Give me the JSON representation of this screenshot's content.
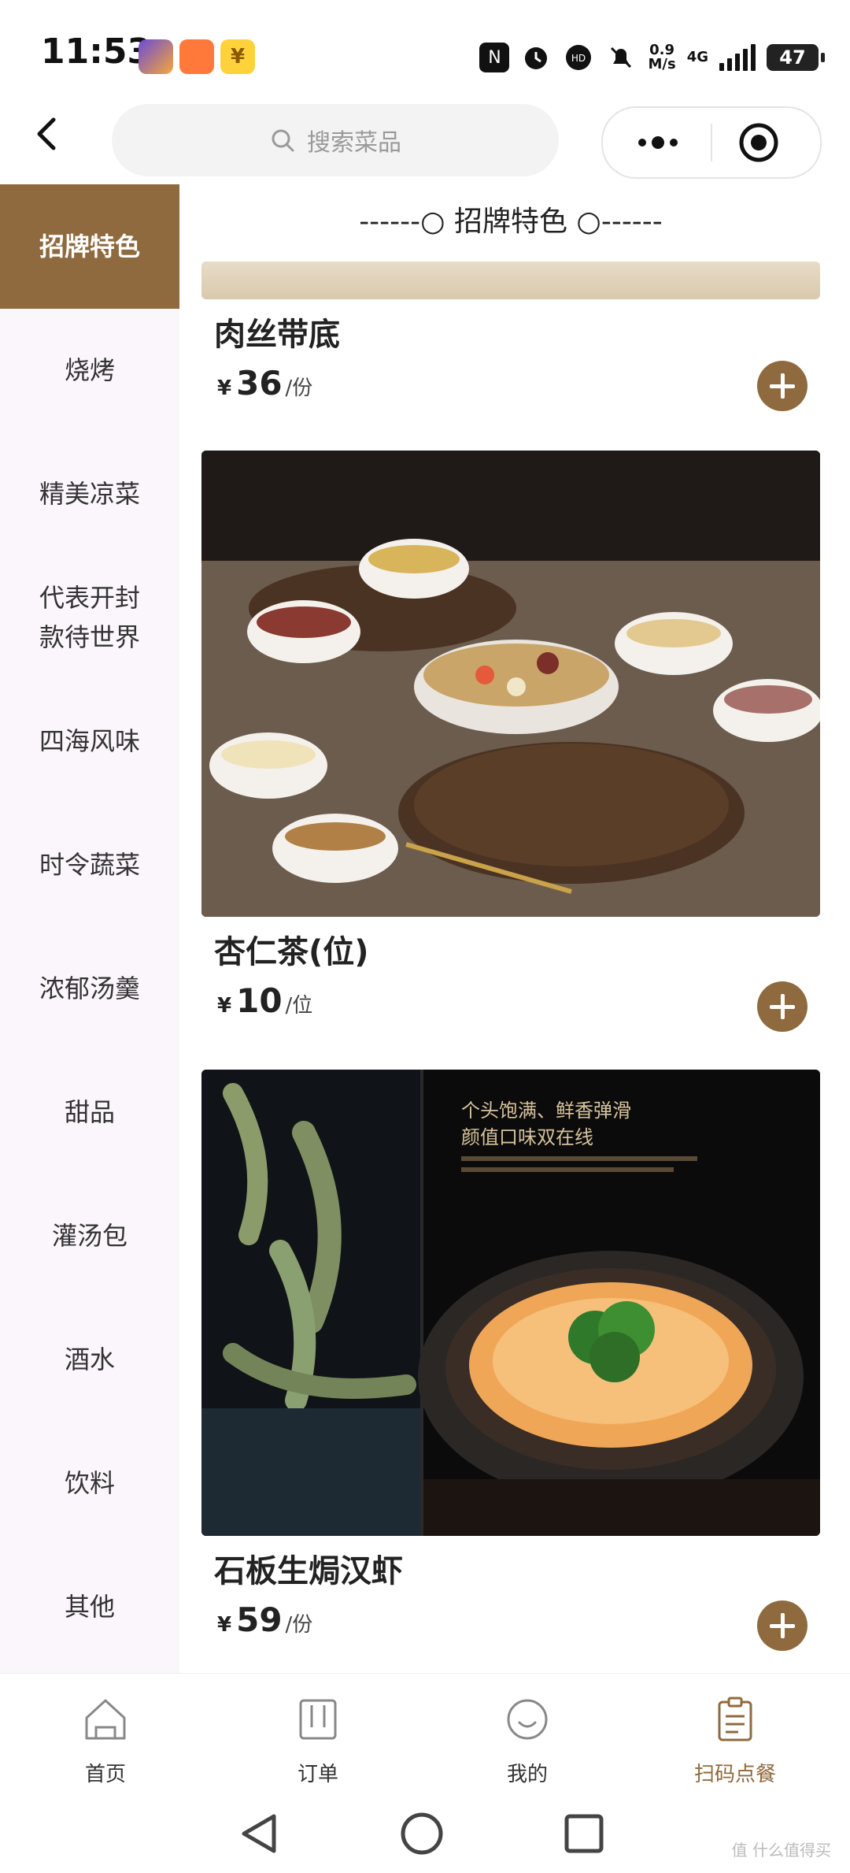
{
  "status_bar": {
    "time": "11:53",
    "net_speed_top": "0.9",
    "net_speed_bottom": "M/s",
    "network": "4G",
    "battery": "47"
  },
  "search": {
    "placeholder": "搜索菜品"
  },
  "sidebar": {
    "items": [
      {
        "label": "招牌特色",
        "active": true
      },
      {
        "label": "烧烤"
      },
      {
        "label": "精美凉菜"
      },
      {
        "label": "代表开封\n款待世界"
      },
      {
        "label": "四海风味"
      },
      {
        "label": "时令蔬菜"
      },
      {
        "label": "浓郁汤羹"
      },
      {
        "label": "甜品"
      },
      {
        "label": "灌汤包"
      },
      {
        "label": "酒水"
      },
      {
        "label": "饮料"
      },
      {
        "label": "其他"
      }
    ]
  },
  "section": {
    "title": "------○ 招牌特色 ○------"
  },
  "dishes": [
    {
      "name": "肉丝带底",
      "currency": "¥",
      "price": "36",
      "unit": "/份"
    },
    {
      "name": "杏仁茶(位)",
      "currency": "¥",
      "price": "10",
      "unit": "/位"
    },
    {
      "name": "石板生焗汉虾",
      "currency": "¥",
      "price": "59",
      "unit": "/份",
      "image_text_line1": "个头饱满、鲜香弹滑",
      "image_text_line2": "颜值口味双在线"
    }
  ],
  "tabbar": {
    "items": [
      {
        "label": "首页"
      },
      {
        "label": "订单"
      },
      {
        "label": "我的"
      },
      {
        "label": "扫码点餐",
        "active": true
      }
    ]
  },
  "watermark": "值 什么值得买",
  "colors": {
    "accent": "#8f6a3e",
    "sidebar_bg": "#fbf6fb"
  }
}
